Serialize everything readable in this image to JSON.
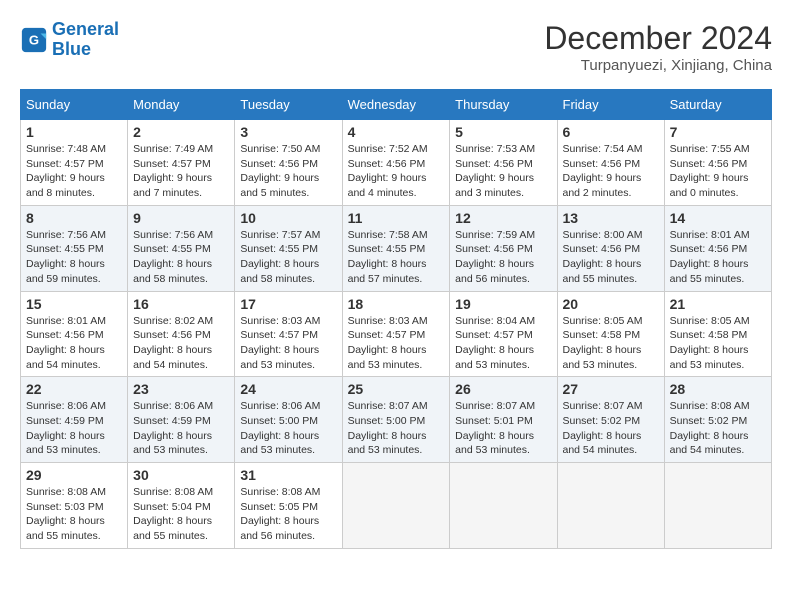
{
  "logo": {
    "line1": "General",
    "line2": "Blue"
  },
  "title": "December 2024",
  "location": "Turpanyuezi, Xinjiang, China",
  "days_of_week": [
    "Sunday",
    "Monday",
    "Tuesday",
    "Wednesday",
    "Thursday",
    "Friday",
    "Saturday"
  ],
  "weeks": [
    [
      {
        "day": 1,
        "sunrise": "7:48 AM",
        "sunset": "4:57 PM",
        "daylight_hours": 9,
        "daylight_mins": 8
      },
      {
        "day": 2,
        "sunrise": "7:49 AM",
        "sunset": "4:57 PM",
        "daylight_hours": 9,
        "daylight_mins": 7
      },
      {
        "day": 3,
        "sunrise": "7:50 AM",
        "sunset": "4:56 PM",
        "daylight_hours": 9,
        "daylight_mins": 5
      },
      {
        "day": 4,
        "sunrise": "7:52 AM",
        "sunset": "4:56 PM",
        "daylight_hours": 9,
        "daylight_mins": 4
      },
      {
        "day": 5,
        "sunrise": "7:53 AM",
        "sunset": "4:56 PM",
        "daylight_hours": 9,
        "daylight_mins": 3
      },
      {
        "day": 6,
        "sunrise": "7:54 AM",
        "sunset": "4:56 PM",
        "daylight_hours": 9,
        "daylight_mins": 2
      },
      {
        "day": 7,
        "sunrise": "7:55 AM",
        "sunset": "4:56 PM",
        "daylight_hours": 9,
        "daylight_mins": 0
      }
    ],
    [
      {
        "day": 8,
        "sunrise": "7:56 AM",
        "sunset": "4:55 PM",
        "daylight_hours": 8,
        "daylight_mins": 59
      },
      {
        "day": 9,
        "sunrise": "7:56 AM",
        "sunset": "4:55 PM",
        "daylight_hours": 8,
        "daylight_mins": 58
      },
      {
        "day": 10,
        "sunrise": "7:57 AM",
        "sunset": "4:55 PM",
        "daylight_hours": 8,
        "daylight_mins": 58
      },
      {
        "day": 11,
        "sunrise": "7:58 AM",
        "sunset": "4:55 PM",
        "daylight_hours": 8,
        "daylight_mins": 57
      },
      {
        "day": 12,
        "sunrise": "7:59 AM",
        "sunset": "4:56 PM",
        "daylight_hours": 8,
        "daylight_mins": 56
      },
      {
        "day": 13,
        "sunrise": "8:00 AM",
        "sunset": "4:56 PM",
        "daylight_hours": 8,
        "daylight_mins": 55
      },
      {
        "day": 14,
        "sunrise": "8:01 AM",
        "sunset": "4:56 PM",
        "daylight_hours": 8,
        "daylight_mins": 55
      }
    ],
    [
      {
        "day": 15,
        "sunrise": "8:01 AM",
        "sunset": "4:56 PM",
        "daylight_hours": 8,
        "daylight_mins": 54
      },
      {
        "day": 16,
        "sunrise": "8:02 AM",
        "sunset": "4:56 PM",
        "daylight_hours": 8,
        "daylight_mins": 54
      },
      {
        "day": 17,
        "sunrise": "8:03 AM",
        "sunset": "4:57 PM",
        "daylight_hours": 8,
        "daylight_mins": 53
      },
      {
        "day": 18,
        "sunrise": "8:03 AM",
        "sunset": "4:57 PM",
        "daylight_hours": 8,
        "daylight_mins": 53
      },
      {
        "day": 19,
        "sunrise": "8:04 AM",
        "sunset": "4:57 PM",
        "daylight_hours": 8,
        "daylight_mins": 53
      },
      {
        "day": 20,
        "sunrise": "8:05 AM",
        "sunset": "4:58 PM",
        "daylight_hours": 8,
        "daylight_mins": 53
      },
      {
        "day": 21,
        "sunrise": "8:05 AM",
        "sunset": "4:58 PM",
        "daylight_hours": 8,
        "daylight_mins": 53
      }
    ],
    [
      {
        "day": 22,
        "sunrise": "8:06 AM",
        "sunset": "4:59 PM",
        "daylight_hours": 8,
        "daylight_mins": 53
      },
      {
        "day": 23,
        "sunrise": "8:06 AM",
        "sunset": "4:59 PM",
        "daylight_hours": 8,
        "daylight_mins": 53
      },
      {
        "day": 24,
        "sunrise": "8:06 AM",
        "sunset": "5:00 PM",
        "daylight_hours": 8,
        "daylight_mins": 53
      },
      {
        "day": 25,
        "sunrise": "8:07 AM",
        "sunset": "5:00 PM",
        "daylight_hours": 8,
        "daylight_mins": 53
      },
      {
        "day": 26,
        "sunrise": "8:07 AM",
        "sunset": "5:01 PM",
        "daylight_hours": 8,
        "daylight_mins": 53
      },
      {
        "day": 27,
        "sunrise": "8:07 AM",
        "sunset": "5:02 PM",
        "daylight_hours": 8,
        "daylight_mins": 54
      },
      {
        "day": 28,
        "sunrise": "8:08 AM",
        "sunset": "5:02 PM",
        "daylight_hours": 8,
        "daylight_mins": 54
      }
    ],
    [
      {
        "day": 29,
        "sunrise": "8:08 AM",
        "sunset": "5:03 PM",
        "daylight_hours": 8,
        "daylight_mins": 55
      },
      {
        "day": 30,
        "sunrise": "8:08 AM",
        "sunset": "5:04 PM",
        "daylight_hours": 8,
        "daylight_mins": 55
      },
      {
        "day": 31,
        "sunrise": "8:08 AM",
        "sunset": "5:05 PM",
        "daylight_hours": 8,
        "daylight_mins": 56
      },
      null,
      null,
      null,
      null
    ]
  ],
  "labels": {
    "sunrise": "Sunrise:",
    "sunset": "Sunset:",
    "daylight": "Daylight:"
  }
}
